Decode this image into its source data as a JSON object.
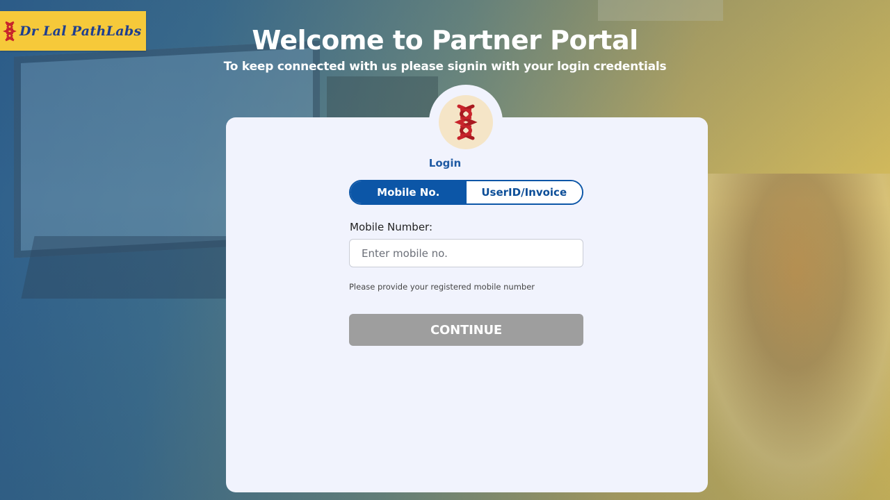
{
  "brand": {
    "name": "Dr Lal PathLabs",
    "icon": "dna-helix-icon",
    "colors": {
      "background": "#f6c93a",
      "text": "#1f3f8f",
      "mark": "#c8242b"
    }
  },
  "header": {
    "title": "Welcome to Partner Portal",
    "subtitle": "To keep connected with us please signin with your login credentials"
  },
  "login": {
    "logo_icon": "dna-helix-icon",
    "heading": "Login",
    "tabs": [
      {
        "label": "Mobile No.",
        "active": true
      },
      {
        "label": "UserID/Invoice",
        "active": false
      }
    ],
    "mobile_label": "Mobile Number:",
    "mobile_value": "",
    "mobile_placeholder": "Enter mobile no.",
    "help_text": "Please provide your registered mobile number",
    "continue_label": "CONTINUE"
  },
  "colors": {
    "accent": "#0c56a7",
    "card": "#f1f3fd",
    "button_disabled": "#9e9e9e"
  }
}
